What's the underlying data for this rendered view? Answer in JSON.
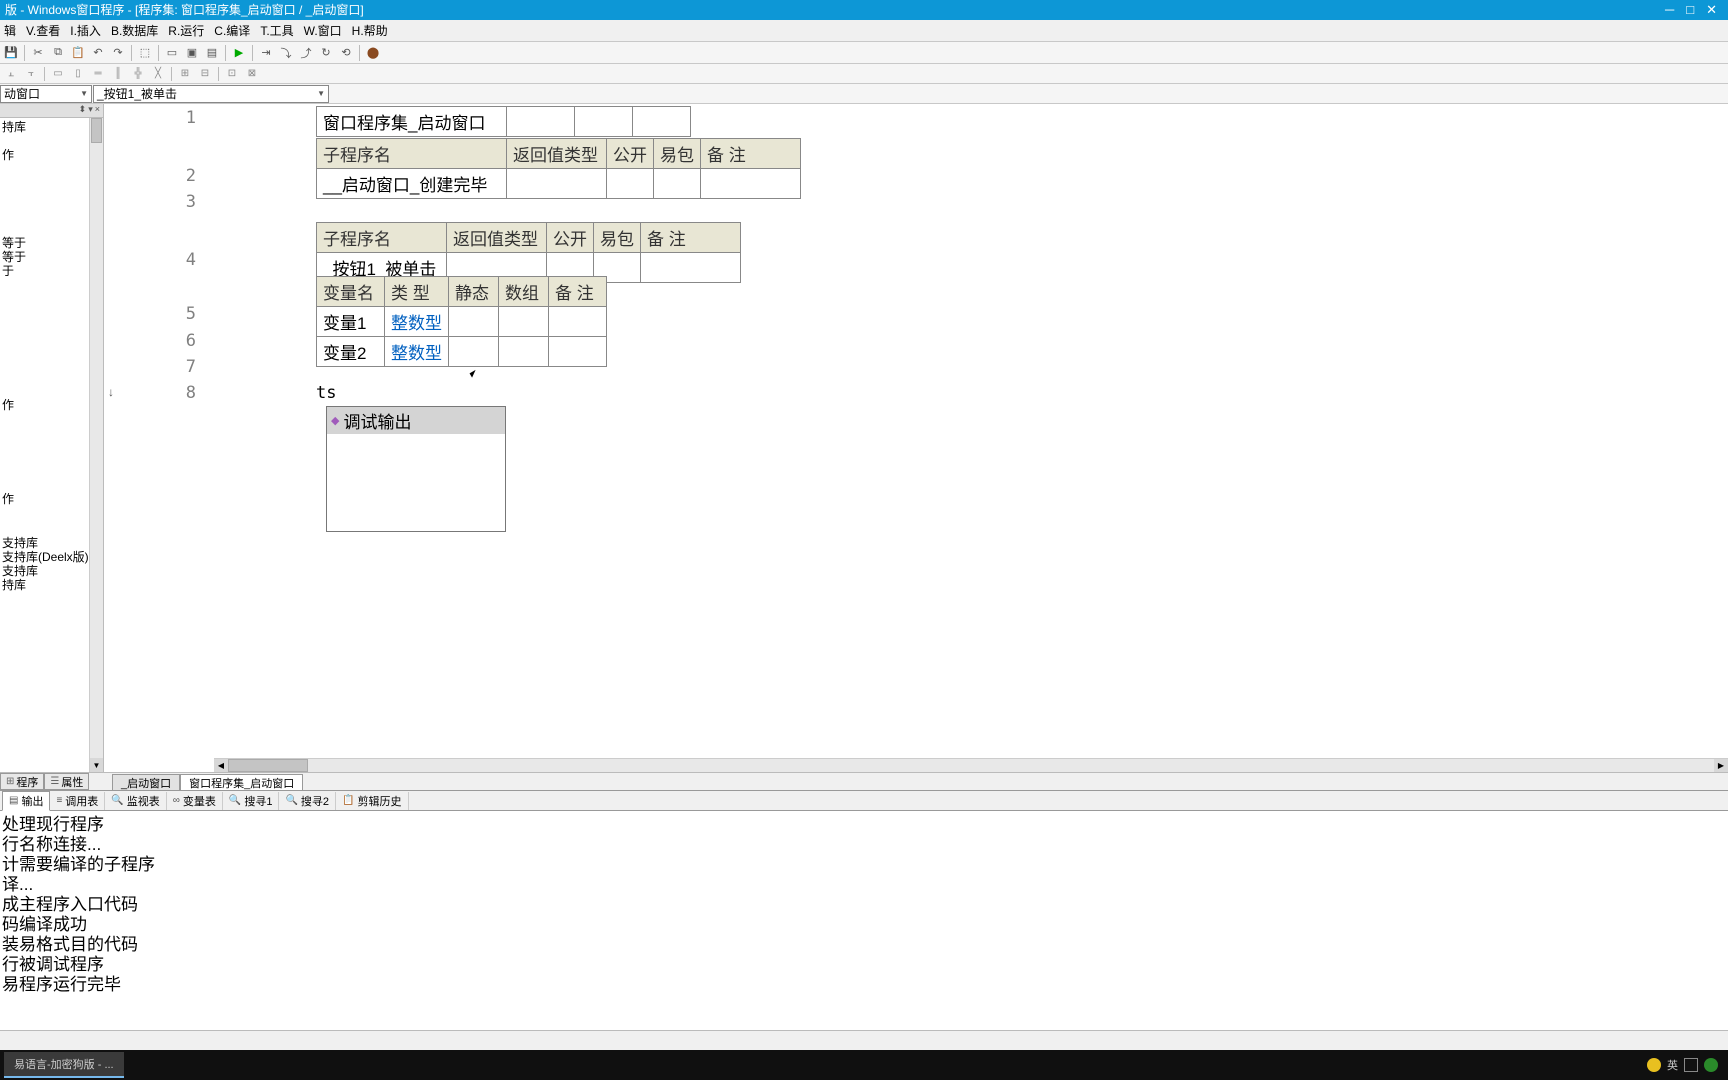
{
  "titlebar": {
    "title": "版 - Windows窗口程序 - [程序集: 窗口程序集_启动窗口 / _启动窗口]"
  },
  "menu": {
    "edit": "辑",
    "view": "V.查看",
    "insert": "I.插入",
    "database": "B.数据库",
    "run": "R.运行",
    "compile": "C.编译",
    "tools": "T.工具",
    "window": "W.窗口",
    "help": "H.帮助"
  },
  "combos": {
    "c1": "动窗口",
    "c2": "_按钮1_被单击"
  },
  "tree": {
    "items": [
      "持库",
      "",
      "作",
      "",
      "等于",
      "等于",
      "于",
      "",
      "",
      "",
      "作",
      "",
      "",
      "",
      "作",
      "支持库",
      "支持库(Deelx版)",
      "支持库",
      "持库"
    ]
  },
  "code": {
    "lines": [
      "1",
      "2",
      "3",
      "4",
      "5",
      "6",
      "7",
      "8"
    ],
    "t1": {
      "r0c0": "窗口程序集_启动窗口"
    },
    "t2": {
      "h0": "子程序名",
      "h1": "返回值类型",
      "h2": "公开",
      "h3": "易包",
      "h4": "备 注",
      "r0c0": "__启动窗口_创建完毕"
    },
    "t3": {
      "h0": "子程序名",
      "h1": "返回值类型",
      "h2": "公开",
      "h3": "易包",
      "h4": "备 注",
      "r0c0": "_按钮1_被单击"
    },
    "t4": {
      "h0": "变量名",
      "h1": "类 型",
      "h2": "静态",
      "h3": "数组",
      "h4": "备 注",
      "r0c0": "变量1",
      "r0c1": "整数型",
      "r1c0": "变量2",
      "r1c1": "整数型"
    },
    "line8": "ts",
    "autocomplete": "调试输出"
  },
  "left_tabs": {
    "t1": "程序",
    "t2": "属性"
  },
  "doc_tabs": {
    "t1": "_启动窗口",
    "t2": "窗口程序集_启动窗口"
  },
  "bottom_tabs": {
    "t1": "输出",
    "t2": "调用表",
    "t3": "监视表",
    "t4": "变量表",
    "t5": "搜寻1",
    "t6": "搜寻2",
    "t7": "剪辑历史"
  },
  "output": {
    "l1": "处理现行程序",
    "l2": "行名称连接...",
    "l3": "计需要编译的子程序",
    "l4": "译...",
    "l5": "成主程序入口代码",
    "l6": "码编译成功",
    "l7": "装易格式目的代码",
    "l8": "行被调试程序",
    "l9": "易程序运行完毕"
  },
  "taskbar": {
    "item": "易语言-加密狗版 - ...",
    "ime": "英"
  }
}
